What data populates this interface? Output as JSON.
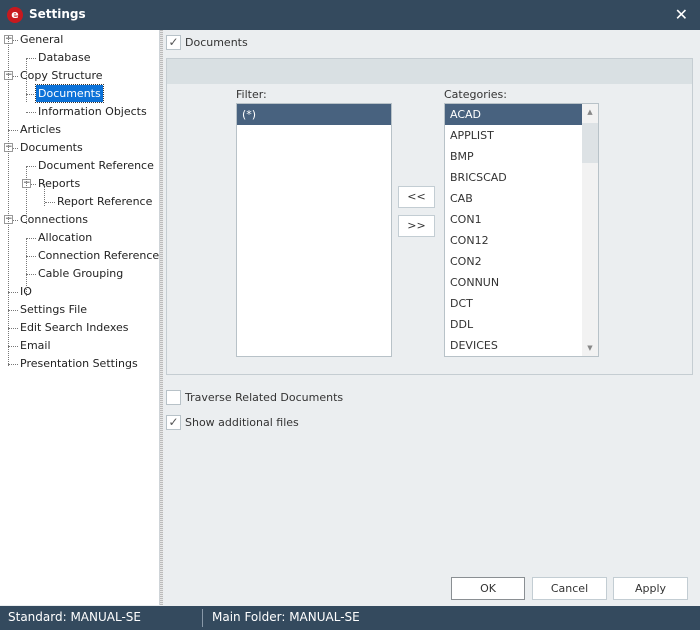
{
  "window": {
    "title": "Settings",
    "app_icon": "e-logo-icon",
    "close_icon": "close-icon"
  },
  "tree": {
    "items": [
      {
        "label": "General",
        "level": 0,
        "expander": "minus"
      },
      {
        "label": "Database",
        "level": 1
      },
      {
        "label": "Copy Structure",
        "level": 0,
        "expander": "minus"
      },
      {
        "label": "Documents",
        "level": 1,
        "selected": true
      },
      {
        "label": "Information Objects",
        "level": 1
      },
      {
        "label": "Articles",
        "level": 0
      },
      {
        "label": "Documents",
        "level": 0,
        "expander": "minus"
      },
      {
        "label": "Document Reference",
        "level": 1
      },
      {
        "label": "Reports",
        "level": 1,
        "expander": "minus"
      },
      {
        "label": "Report Reference",
        "level": 2
      },
      {
        "label": "Connections",
        "level": 0,
        "expander": "minus"
      },
      {
        "label": "Allocation",
        "level": 1
      },
      {
        "label": "Connection Reference",
        "level": 1
      },
      {
        "label": "Cable Grouping",
        "level": 1
      },
      {
        "label": "IO",
        "level": 0
      },
      {
        "label": "Settings File",
        "level": 0
      },
      {
        "label": "Edit Search Indexes",
        "level": 0
      },
      {
        "label": "Email",
        "level": 0
      },
      {
        "label": "Presentation Settings",
        "level": 0
      }
    ]
  },
  "main": {
    "documents_checkbox": {
      "label": "Documents",
      "checked": true,
      "glyph": "✓"
    },
    "filter": {
      "label": "Filter:",
      "items": [
        "(*)"
      ],
      "selected_index": 0
    },
    "categories": {
      "label": "Categories:",
      "items": [
        "ACAD",
        "APPLIST",
        "BMP",
        "BRICSCAD",
        "CAB",
        "CON1",
        "CON12",
        "CON2",
        "CONNUN",
        "DCT",
        "DDL",
        "DEVICES"
      ],
      "selected_index": 0
    },
    "move_left_label": "<<",
    "move_right_label": ">>",
    "traverse_checkbox": {
      "label": "Traverse Related Documents",
      "checked": false
    },
    "show_files_checkbox": {
      "label": "Show additional files",
      "checked": true,
      "glyph": "✓"
    }
  },
  "buttons": {
    "ok": "OK",
    "cancel": "Cancel",
    "apply": "Apply"
  },
  "status_bar": {
    "standard": "Standard: MANUAL-SE",
    "main_folder": "Main Folder: MANUAL-SE"
  },
  "colors": {
    "titlebar": "#344a5e",
    "selection": "#0c72d8",
    "list_selection": "#48627f"
  }
}
